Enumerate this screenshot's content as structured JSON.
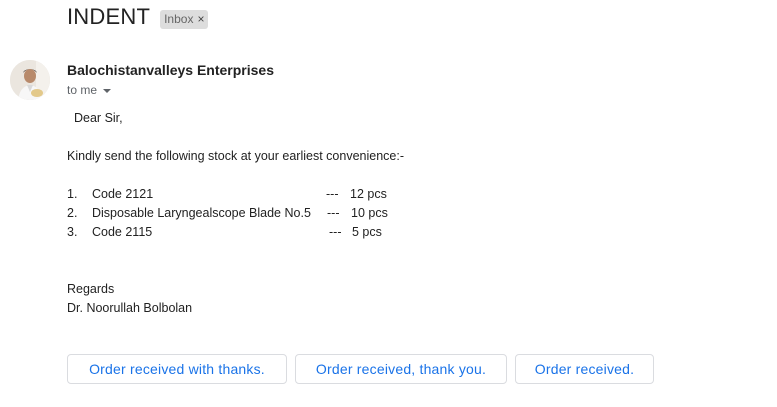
{
  "email": {
    "subject": "INDENT",
    "label": "Inbox",
    "label_remove": "×",
    "sender": "Balochistanvalleys Enterprises",
    "recipient_line": "to me"
  },
  "body": {
    "greeting": "Dear Sir,",
    "request": "Kindly send the following stock at your earliest convenience:-",
    "items": [
      {
        "num": "1.",
        "name": "Code 2121",
        "dash": "---",
        "qty": "12 pcs"
      },
      {
        "num": "2.",
        "name": "Disposable Laryngealscope Blade No.5",
        "dash": "---",
        "qty": "10 pcs"
      },
      {
        "num": "3.",
        "name": "Code 2115",
        "dash": "---",
        "qty": "5 pcs"
      }
    ],
    "closing": "Regards",
    "signature": "Dr. Noorullah Bolbolan"
  },
  "smart_replies": [
    "Order received with thanks.",
    "Order received, thank you.",
    "Order received."
  ],
  "icons": {
    "dropdown": "chevron-down-icon",
    "remove": "close-icon"
  },
  "colors": {
    "reply_text": "#1a73e8",
    "label_bg": "#dddddd"
  }
}
